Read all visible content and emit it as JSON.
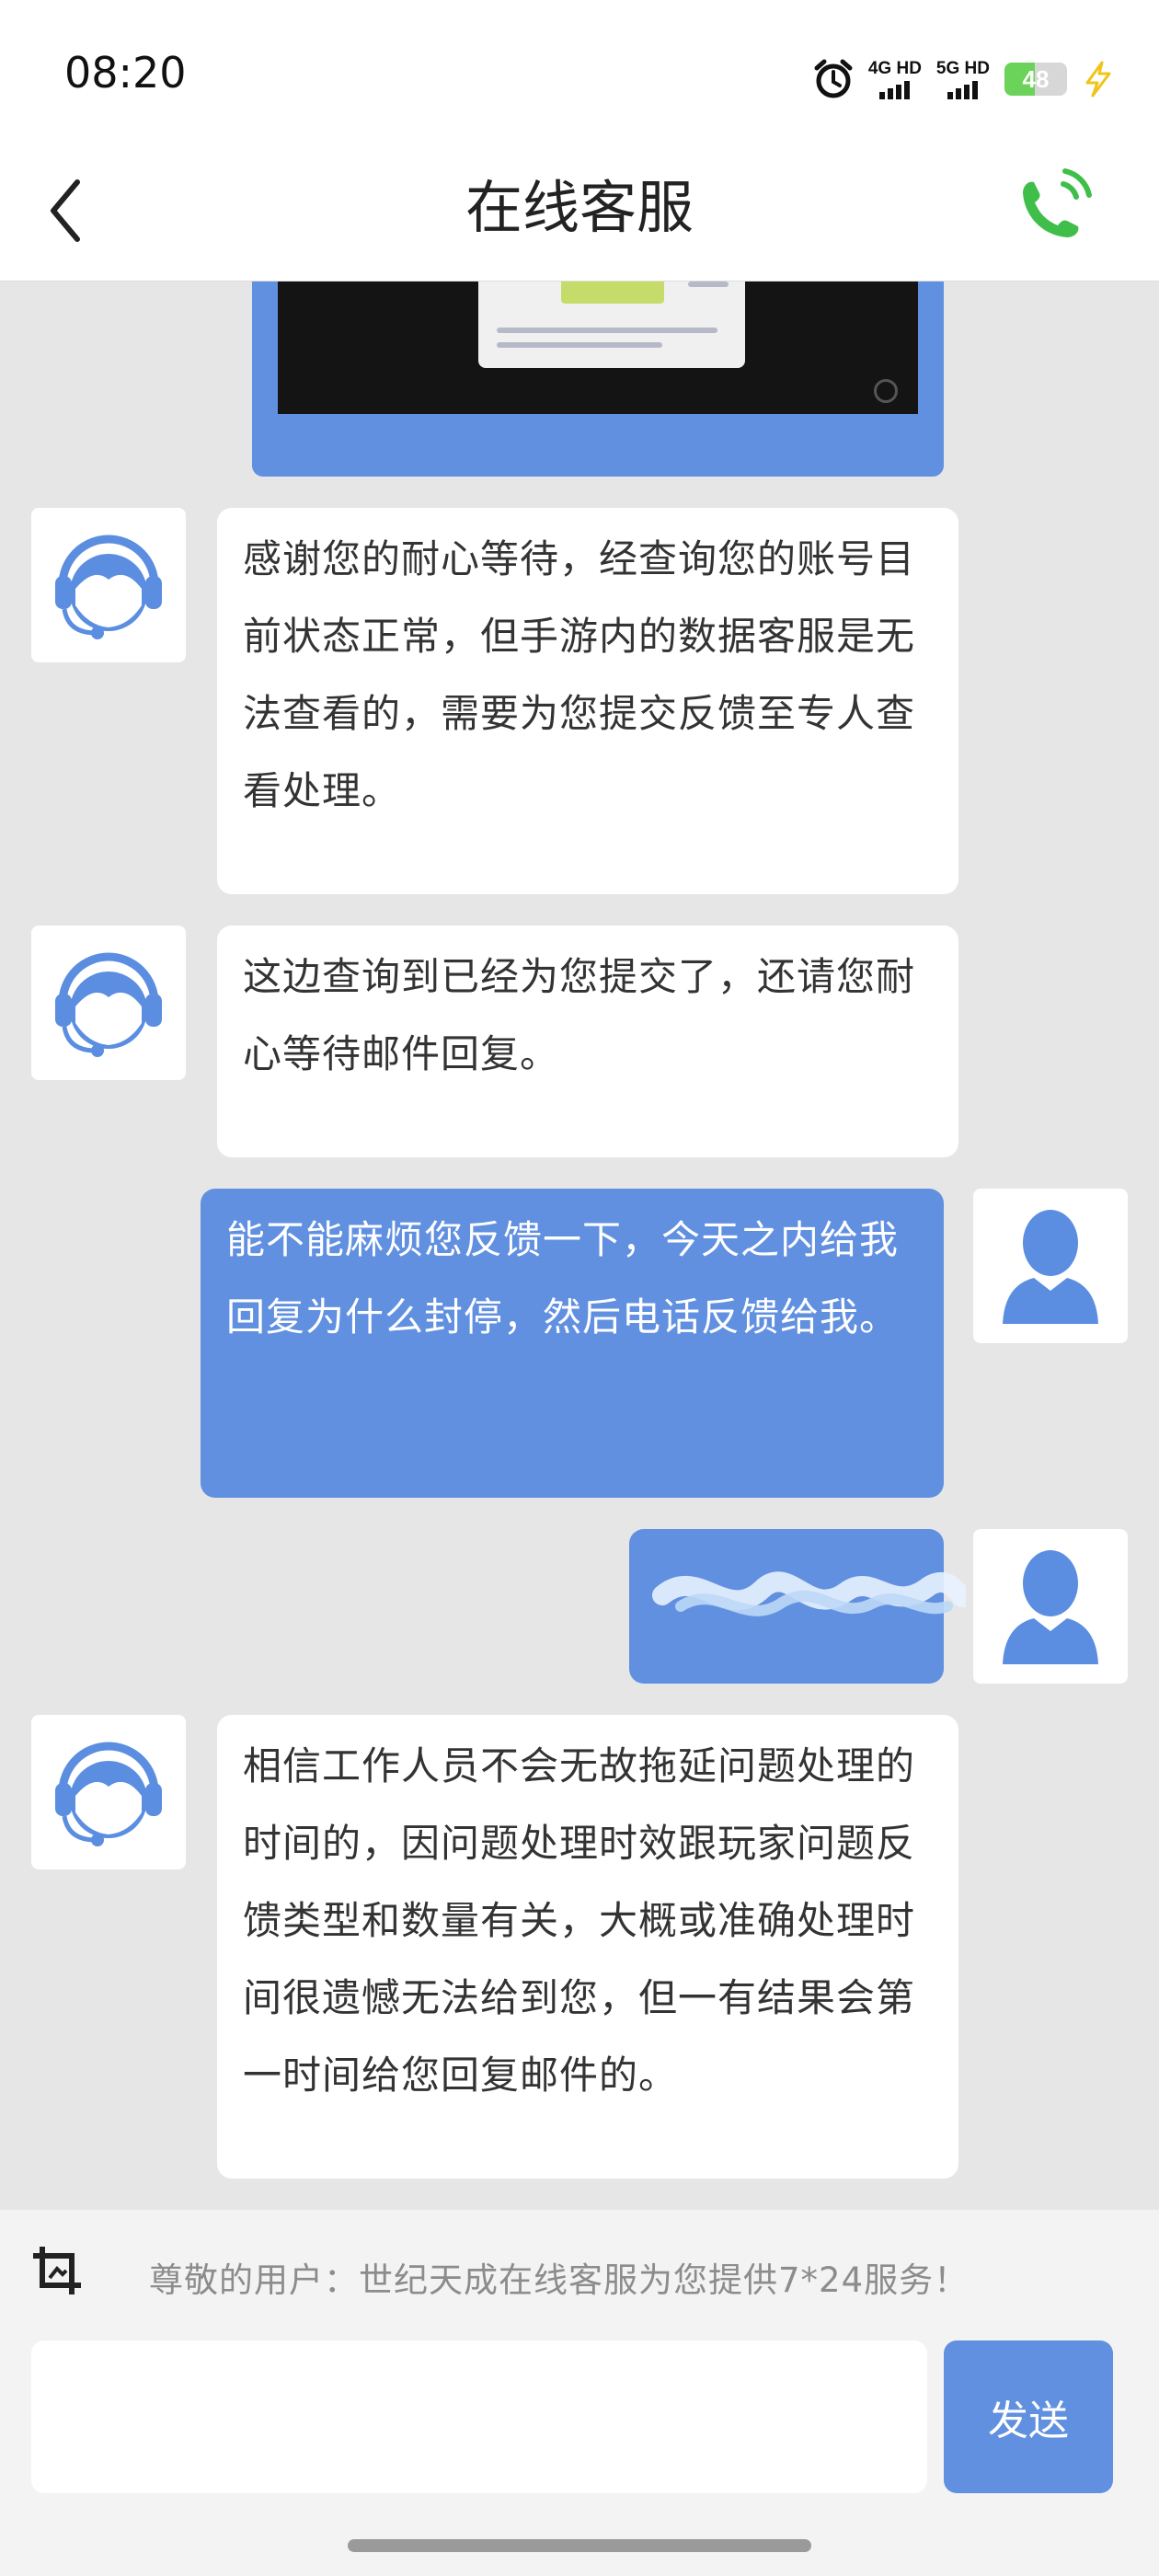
{
  "status_bar": {
    "time": "08:20",
    "network_1": "4G HD",
    "network_2": "5G HD",
    "battery_level": "48",
    "battery_fraction": 0.48,
    "icons": [
      "alarm-icon",
      "signal-icon",
      "battery-icon",
      "charging-icon"
    ]
  },
  "header": {
    "title": "在线客服",
    "back_icon": "chevron-left-icon",
    "call_icon": "phone-call-icon"
  },
  "chat": {
    "messages": [
      {
        "from": "agent",
        "text": "感谢您的耐心等待，经查询您的账号目前状态正常，但手游内的数据客服是无法查看的，需要为您提交反馈至专人查看处理。"
      },
      {
        "from": "agent",
        "text": "这边查询到已经为您提交了，还请您耐心等待邮件回复。"
      },
      {
        "from": "user",
        "text": "能不能麻烦您反馈一下，今天之内给我回复为什么封停，然后电话反馈给我。"
      },
      {
        "from": "user",
        "text": ""
      },
      {
        "from": "agent",
        "text": "相信工作人员不会无故拖延问题处理的时间的，因问题处理时效跟玩家问题反馈类型和数量有关，大概或准确处理时间很遗憾无法给到您，但一有结果会第一时间给您回复邮件的。"
      }
    ]
  },
  "footer": {
    "notice": "尊敬的用户：世纪天成在线客服为您提供7*24服务！",
    "input_value": "",
    "send_label": "发送"
  },
  "colors": {
    "accent": "#6190e0",
    "chat_background": "#e6e6e6",
    "call_green": "#3fbf4a"
  }
}
